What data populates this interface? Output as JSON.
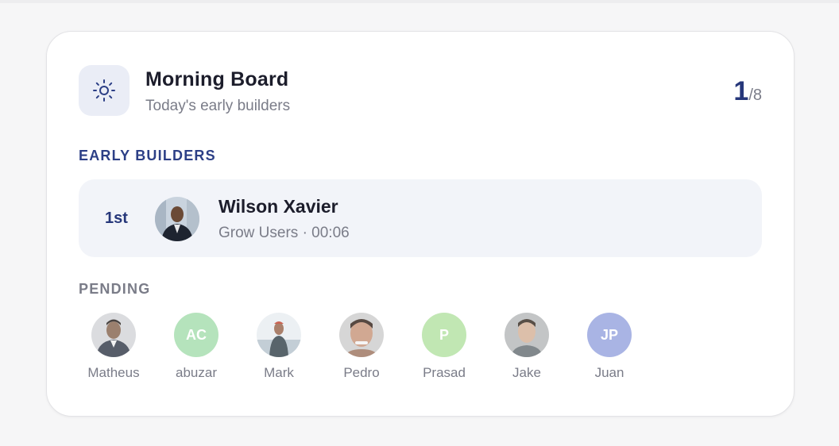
{
  "header": {
    "title": "Morning Board",
    "subtitle": "Today's early builders",
    "icon": "sun-icon",
    "count": "1",
    "total": "/8"
  },
  "early": {
    "label": "EARLY BUILDERS",
    "leader": {
      "rank": "1st",
      "name": "Wilson Xavier",
      "meta": "Grow Users · 00:06",
      "avatar": "photo"
    }
  },
  "pending": {
    "label": "PENDING",
    "users": [
      {
        "name": "Matheus",
        "initials": "",
        "avatar": "photo"
      },
      {
        "name": "abuzar",
        "initials": "AC",
        "avatar": "initials",
        "color": "#a9dfb1"
      },
      {
        "name": "Mark",
        "initials": "",
        "avatar": "photo"
      },
      {
        "name": "Pedro",
        "initials": "",
        "avatar": "photo"
      },
      {
        "name": "Prasad",
        "initials": "P",
        "avatar": "initials",
        "color": "#b7e3a6"
      },
      {
        "name": "Jake",
        "initials": "",
        "avatar": "photo"
      },
      {
        "name": "Juan",
        "initials": "JP",
        "avatar": "initials",
        "color": "#9ba8e0"
      }
    ]
  },
  "colors": {
    "accent": "#26377a",
    "muted": "#7a7c88",
    "leader_bg": "#f2f4f9"
  }
}
